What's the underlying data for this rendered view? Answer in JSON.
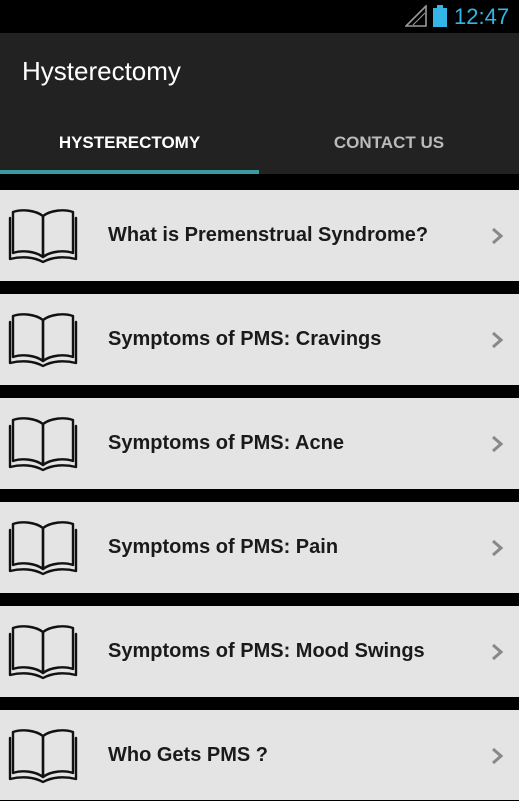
{
  "status_bar": {
    "time": "12:47",
    "signal_icon": "signal-icon",
    "battery_icon": "battery-icon",
    "time_color": "#33b5e5"
  },
  "action_bar": {
    "title": "Hysterectomy"
  },
  "tabs": [
    {
      "label": "HYSTERECTOMY",
      "selected": true
    },
    {
      "label": "CONTACT US",
      "selected": false
    }
  ],
  "colors": {
    "accent": "#3a9aa0",
    "bar_bg": "#222222",
    "item_bg": "#e4e4e4"
  },
  "items": [
    {
      "label": "What is Premenstrual Syndrome?",
      "icon": "book-icon"
    },
    {
      "label": "Symptoms of PMS: Cravings",
      "icon": "book-icon"
    },
    {
      "label": "Symptoms of PMS: Acne",
      "icon": "book-icon"
    },
    {
      "label": "Symptoms of PMS: Pain",
      "icon": "book-icon"
    },
    {
      "label": "Symptoms of PMS: Mood Swings",
      "icon": "book-icon"
    },
    {
      "label": "Who Gets PMS ?",
      "icon": "book-icon"
    }
  ]
}
